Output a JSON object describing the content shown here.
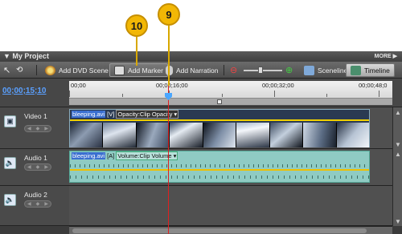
{
  "callouts": [
    "10",
    "9"
  ],
  "panel": {
    "title": "My Project",
    "more_label": "MORE"
  },
  "toolbar": {
    "add_dvd_scene": "Add DVD Scene",
    "add_marker": "Add Marker",
    "add_narration": "Add Narration",
    "sceneline": "Sceneline",
    "timeline": "Timeline"
  },
  "timecode": "00;00;15;10",
  "ruler": {
    "labels": [
      "00;00",
      "00;00;16;00",
      "00;00;32;00",
      "00;00;48;0"
    ]
  },
  "tracks": [
    {
      "name": "Video 1",
      "clip_file": "bleeping.avi",
      "clip_tag": "[V]",
      "clip_prop": "Opacity:Clip Opacity"
    },
    {
      "name": "Audio 1",
      "clip_file": "bleeping.avi",
      "clip_tag": "[A]",
      "clip_prop": "Volume:Clip Volume"
    },
    {
      "name": "Audio 2"
    }
  ],
  "colors": {
    "playhead": "#e02020",
    "callout": "#f2b705",
    "timecode": "#5aa0ff"
  }
}
